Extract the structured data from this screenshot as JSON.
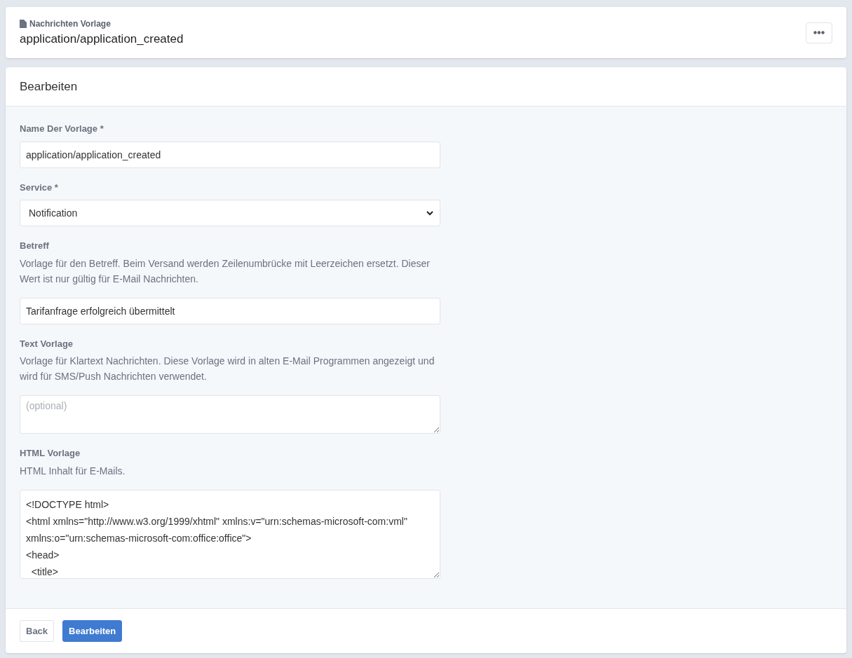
{
  "header": {
    "subtitle": "Nachrichten Vorlage",
    "title": "application/application_created"
  },
  "card": {
    "title": "Bearbeiten",
    "fields": [
      {
        "kind": "input",
        "label": "Name Der Vorlage *",
        "value": "application/application_created"
      },
      {
        "kind": "select",
        "label": "Service *",
        "value": "Notification"
      },
      {
        "kind": "input",
        "label": "Betreff",
        "help": "Vorlage für den Betreff. Beim Versand werden Zeilenumbrücke mit Leerzeichen ersetzt. Dieser Wert ist nur gültig für E-Mail Nachrichten.",
        "value": "Tarifanfrage erfolgreich übermittelt"
      },
      {
        "kind": "textarea",
        "label": "Text Vorlage",
        "help": "Vorlage für Klartext Nachrichten. Diese Vorlage wird in alten E-Mail Programmen angezeigt und wird für SMS/Push Nachrichten verwendet.",
        "placeholder": "(optional)"
      },
      {
        "kind": "code",
        "label": "HTML Vorlage",
        "help": "HTML Inhalt für E-Mails.",
        "value": "<!DOCTYPE html>\n<html xmlns=\"http://www.w3.org/1999/xhtml\" xmlns:v=\"urn:schemas-microsoft-com:vml\" xmlns:o=\"urn:schemas-microsoft-com:office:office\">\n<head>\n  <title>"
      }
    ],
    "buttons": [
      {
        "label": "Back",
        "kind": "secondary"
      },
      {
        "label": "Bearbeiten",
        "kind": "primary"
      }
    ]
  }
}
